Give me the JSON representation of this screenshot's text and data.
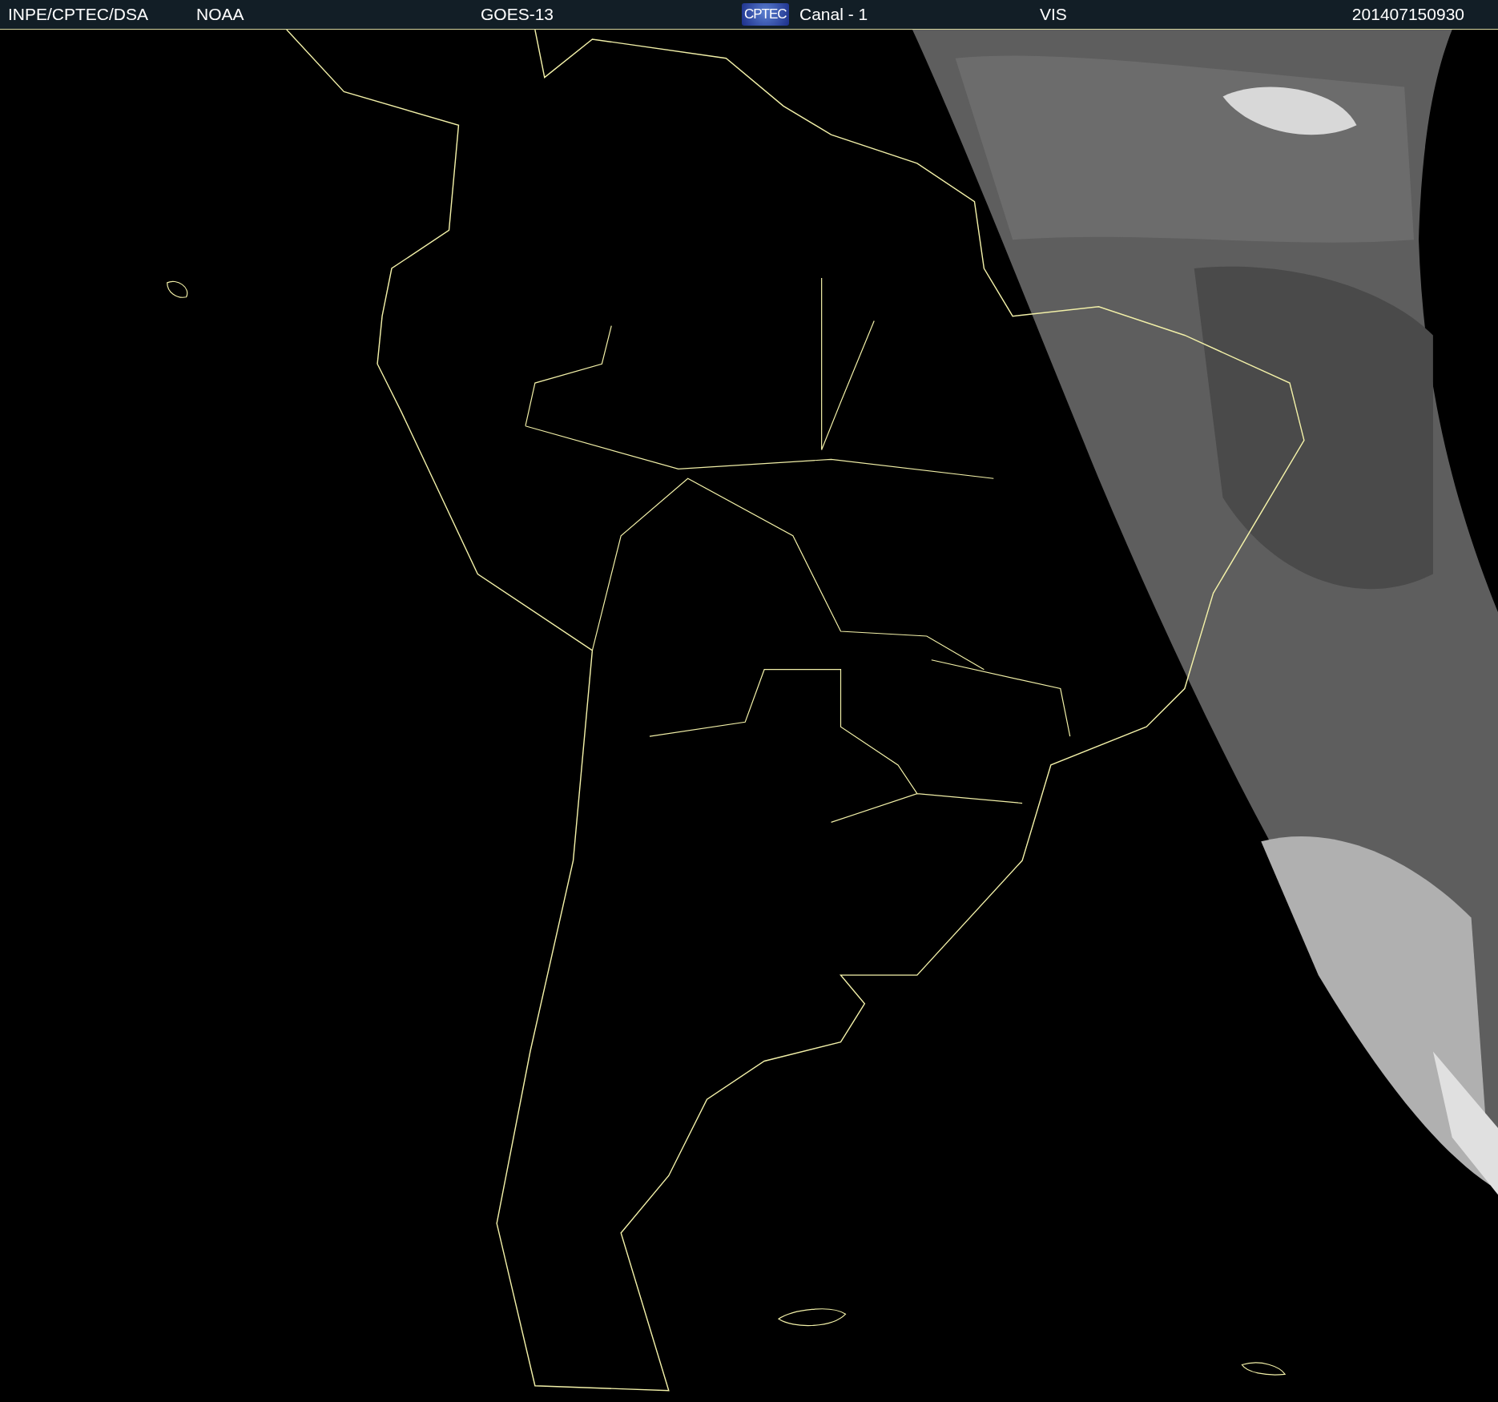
{
  "header": {
    "items": [
      {
        "kind": "text",
        "text": "INPE/CPTEC/DSA"
      },
      {
        "kind": "text",
        "text": "NOAA"
      },
      {
        "kind": "text",
        "text": "GOES-13"
      },
      {
        "kind": "logo",
        "text": "CPTEC"
      },
      {
        "kind": "text",
        "text": "Canal - 1"
      },
      {
        "kind": "text",
        "text": "VIS"
      },
      {
        "kind": "text",
        "text": "201407150930"
      }
    ]
  }
}
